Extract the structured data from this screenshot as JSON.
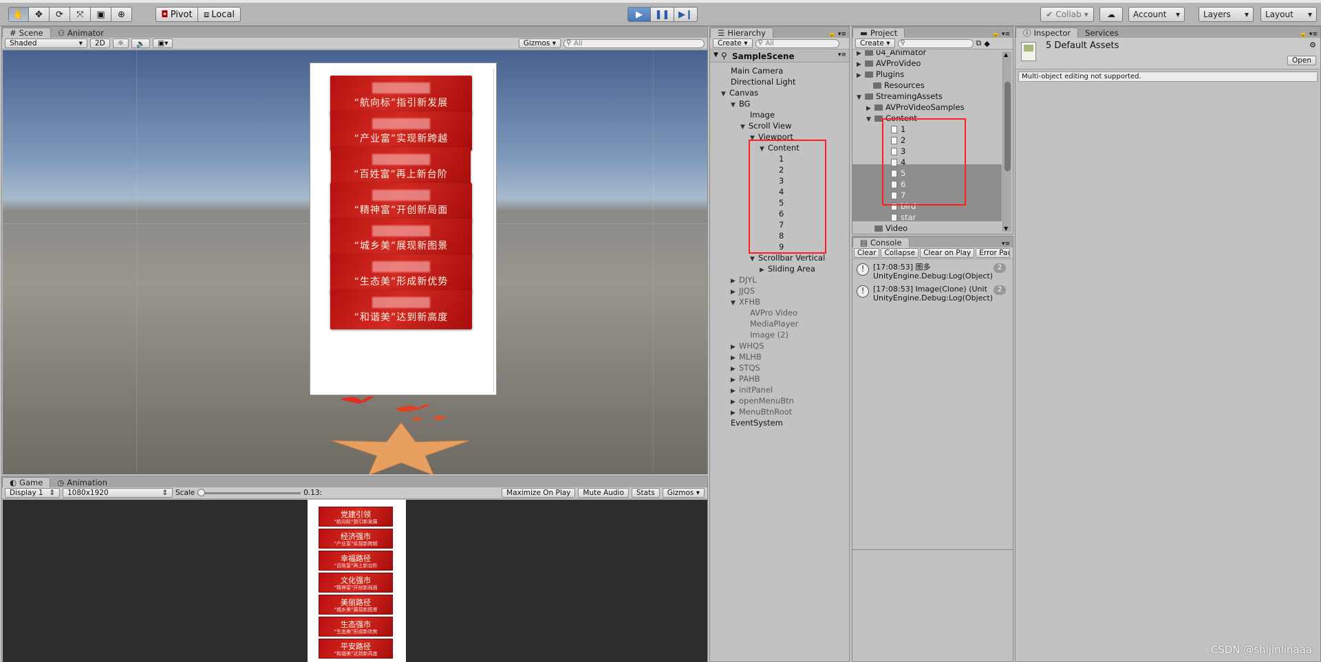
{
  "toolbar": {
    "tools": [
      "hand-tool-icon",
      "move-tool-icon",
      "rotate-tool-icon",
      "scale-tool-icon",
      "rect-tool-icon",
      "transform-tool-icon"
    ],
    "pivot_label": "Pivot",
    "local_label": "Local",
    "collab_label": "Collab",
    "account_label": "Account",
    "layers_label": "Layers",
    "layout_label": "Layout"
  },
  "scene": {
    "tab_scene": "Scene",
    "tab_animator": "Animator",
    "shading": "Shaded",
    "mode_2d": "2D",
    "gizmos": "Gizmos",
    "search_placeholder": "All",
    "cards": [
      "“航向标”指引新发展",
      "“产业富”实现新跨越",
      "“百姓富”再上新台阶",
      "“精神富”开创新局面",
      "“城乡美”展现新图景",
      "“生态美”形成新优势",
      "“和谐美”达到新高度"
    ]
  },
  "game": {
    "tab_game": "Game",
    "tab_animation": "Animation",
    "display": "Display 1",
    "resolution": "1080x1920",
    "scale_label": "Scale",
    "scale_value": "0.13:",
    "maximize": "Maximize On Play",
    "mute": "Mute Audio",
    "stats": "Stats",
    "gizmos": "Gizmos",
    "cards": [
      {
        "title": "党建引领",
        "sub": "“航向标”指引新发展"
      },
      {
        "title": "经济强市",
        "sub": "“产业富”实现新跨越"
      },
      {
        "title": "幸福路径",
        "sub": "“百姓富”再上新台阶"
      },
      {
        "title": "文化强市",
        "sub": "“精神富”开创新局面"
      },
      {
        "title": "美丽路径",
        "sub": "“城乡美”展现新图景"
      },
      {
        "title": "生态强市",
        "sub": "“生态美”形成新优势"
      },
      {
        "title": "平安路径",
        "sub": "“和谐美”达到新高度"
      }
    ]
  },
  "hierarchy": {
    "tab": "Hierarchy",
    "create": "Create",
    "search_placeholder": "All",
    "scene_name": "SampleScene",
    "items": [
      {
        "label": "Main Camera",
        "arrow": "",
        "dim": false
      },
      {
        "label": "Directional Light",
        "arrow": "",
        "dim": false
      },
      {
        "label": "Canvas",
        "arrow": "▼",
        "dim": false
      },
      {
        "label": "BG",
        "arrow": "▼",
        "dim": false
      },
      {
        "label": "Image",
        "arrow": "",
        "dim": false
      },
      {
        "label": "Scroll View",
        "arrow": "▼",
        "dim": false
      },
      {
        "label": "Viewport",
        "arrow": "▼",
        "dim": false
      },
      {
        "label": "Content",
        "arrow": "▼",
        "dim": false
      },
      {
        "label": "1",
        "arrow": "",
        "dim": false
      },
      {
        "label": "2",
        "arrow": "",
        "dim": false
      },
      {
        "label": "3",
        "arrow": "",
        "dim": false
      },
      {
        "label": "4",
        "arrow": "",
        "dim": false
      },
      {
        "label": "5",
        "arrow": "",
        "dim": false
      },
      {
        "label": "6",
        "arrow": "",
        "dim": false
      },
      {
        "label": "7",
        "arrow": "",
        "dim": false
      },
      {
        "label": "8",
        "arrow": "",
        "dim": false
      },
      {
        "label": "9",
        "arrow": "",
        "dim": false
      },
      {
        "label": "Scrollbar Vertical",
        "arrow": "▼",
        "dim": false
      },
      {
        "label": "Sliding Area",
        "arrow": "▶",
        "dim": false
      },
      {
        "label": "DJYL",
        "arrow": "▶",
        "dim": true
      },
      {
        "label": "JJQS",
        "arrow": "▶",
        "dim": true
      },
      {
        "label": "XFHB",
        "arrow": "▼",
        "dim": true
      },
      {
        "label": "AVPro Video",
        "arrow": "",
        "dim": true
      },
      {
        "label": "MediaPlayer",
        "arrow": "",
        "dim": true
      },
      {
        "label": "Image (2)",
        "arrow": "",
        "dim": true
      },
      {
        "label": "WHQS",
        "arrow": "▶",
        "dim": true
      },
      {
        "label": "MLHB",
        "arrow": "▶",
        "dim": true
      },
      {
        "label": "STQS",
        "arrow": "▶",
        "dim": true
      },
      {
        "label": "PAHB",
        "arrow": "▶",
        "dim": true
      },
      {
        "label": "initPanel",
        "arrow": "▶",
        "dim": true
      },
      {
        "label": "openMenuBtn",
        "arrow": "▶",
        "dim": true
      },
      {
        "label": "MenuBtnRoot",
        "arrow": "▶",
        "dim": true
      },
      {
        "label": "EventSystem",
        "arrow": "",
        "dim": false
      }
    ]
  },
  "project": {
    "tab": "Project",
    "create": "Create",
    "items": [
      {
        "label": "04_Animator",
        "type": "folder",
        "arrow": "▶"
      },
      {
        "label": "AVProVideo",
        "type": "folder",
        "arrow": "▶"
      },
      {
        "label": "Plugins",
        "type": "folder",
        "arrow": "▶"
      },
      {
        "label": "Resources",
        "type": "folder",
        "arrow": ""
      },
      {
        "label": "StreamingAssets",
        "type": "folder",
        "arrow": "▼"
      },
      {
        "label": "AVProVideoSamples",
        "type": "folder",
        "arrow": "▶"
      },
      {
        "label": "Content",
        "type": "folder",
        "arrow": "▼"
      },
      {
        "label": "1",
        "type": "file",
        "arrow": ""
      },
      {
        "label": "2",
        "type": "file",
        "arrow": ""
      },
      {
        "label": "3",
        "type": "file",
        "arrow": ""
      },
      {
        "label": "4",
        "type": "file",
        "arrow": ""
      },
      {
        "label": "5",
        "type": "file",
        "arrow": ""
      },
      {
        "label": "6",
        "type": "file",
        "arrow": ""
      },
      {
        "label": "7",
        "type": "file",
        "arrow": ""
      },
      {
        "label": "bird",
        "type": "file",
        "arrow": ""
      },
      {
        "label": "star",
        "type": "file",
        "arrow": ""
      },
      {
        "label": "Video",
        "type": "folder",
        "arrow": ""
      }
    ]
  },
  "console": {
    "tab": "Console",
    "clear": "Clear",
    "collapse": "Collapse",
    "clear_on_play": "Clear on Play",
    "error_pause": "Error Pau",
    "rows": [
      {
        "line1": "[17:08:53] 图多",
        "line2": "UnityEngine.Debug:Log(Object)",
        "count": "2"
      },
      {
        "line1": "[17:08:53] Image(Clone) (Unit",
        "line2": "UnityEngine.Debug:Log(Object)",
        "count": "2"
      }
    ]
  },
  "inspector": {
    "tab": "Inspector",
    "services": "Services",
    "title": "5 Default Assets",
    "open": "Open",
    "message": "Multi-object editing not supported."
  },
  "watermark": "CSDN @shijinlinaaa"
}
